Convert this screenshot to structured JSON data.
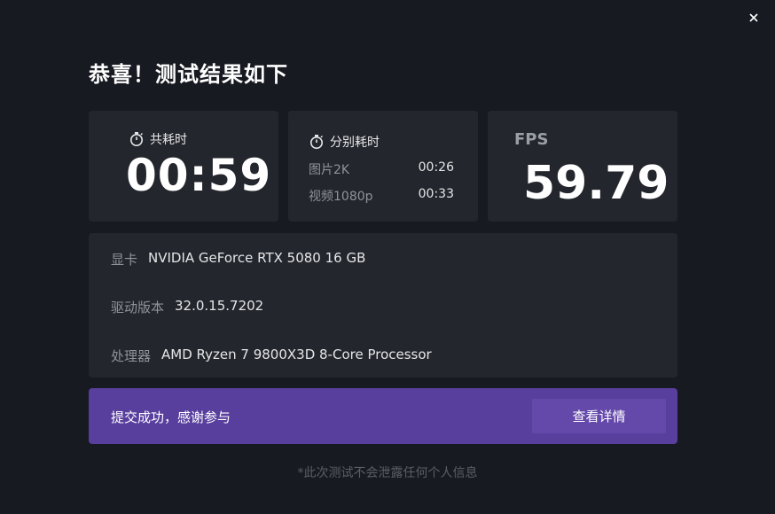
{
  "window": {
    "close_icon": "close-icon"
  },
  "title": "恭喜！测试结果如下",
  "total_time": {
    "icon": "stopwatch-icon",
    "label": "共耗时",
    "value": "00:59"
  },
  "split_time": {
    "icon": "stopwatch-icon",
    "label": "分别耗时",
    "rows": [
      {
        "label": "图片2K",
        "value": "00:26"
      },
      {
        "label": "视频1080p",
        "value": "00:33"
      }
    ]
  },
  "fps": {
    "label": "FPS",
    "value": "59.79"
  },
  "system_info": [
    {
      "label": "显卡",
      "value": "NVIDIA GeForce RTX 5080 16 GB"
    },
    {
      "label": "驱动版本",
      "value": "32.0.15.7202"
    },
    {
      "label": "处理器",
      "value": "AMD Ryzen 7 9800X3D 8-Core Processor"
    }
  ],
  "banner": {
    "message": "提交成功，感谢参与",
    "button_label": "查看详情"
  },
  "footer_note": "*此次测试不会泄露任何个人信息",
  "colors": {
    "background": "#171a21",
    "card": "#23262d",
    "accent": "#583f9e",
    "accent_button": "#6449ab",
    "muted_text": "#8f939b"
  }
}
